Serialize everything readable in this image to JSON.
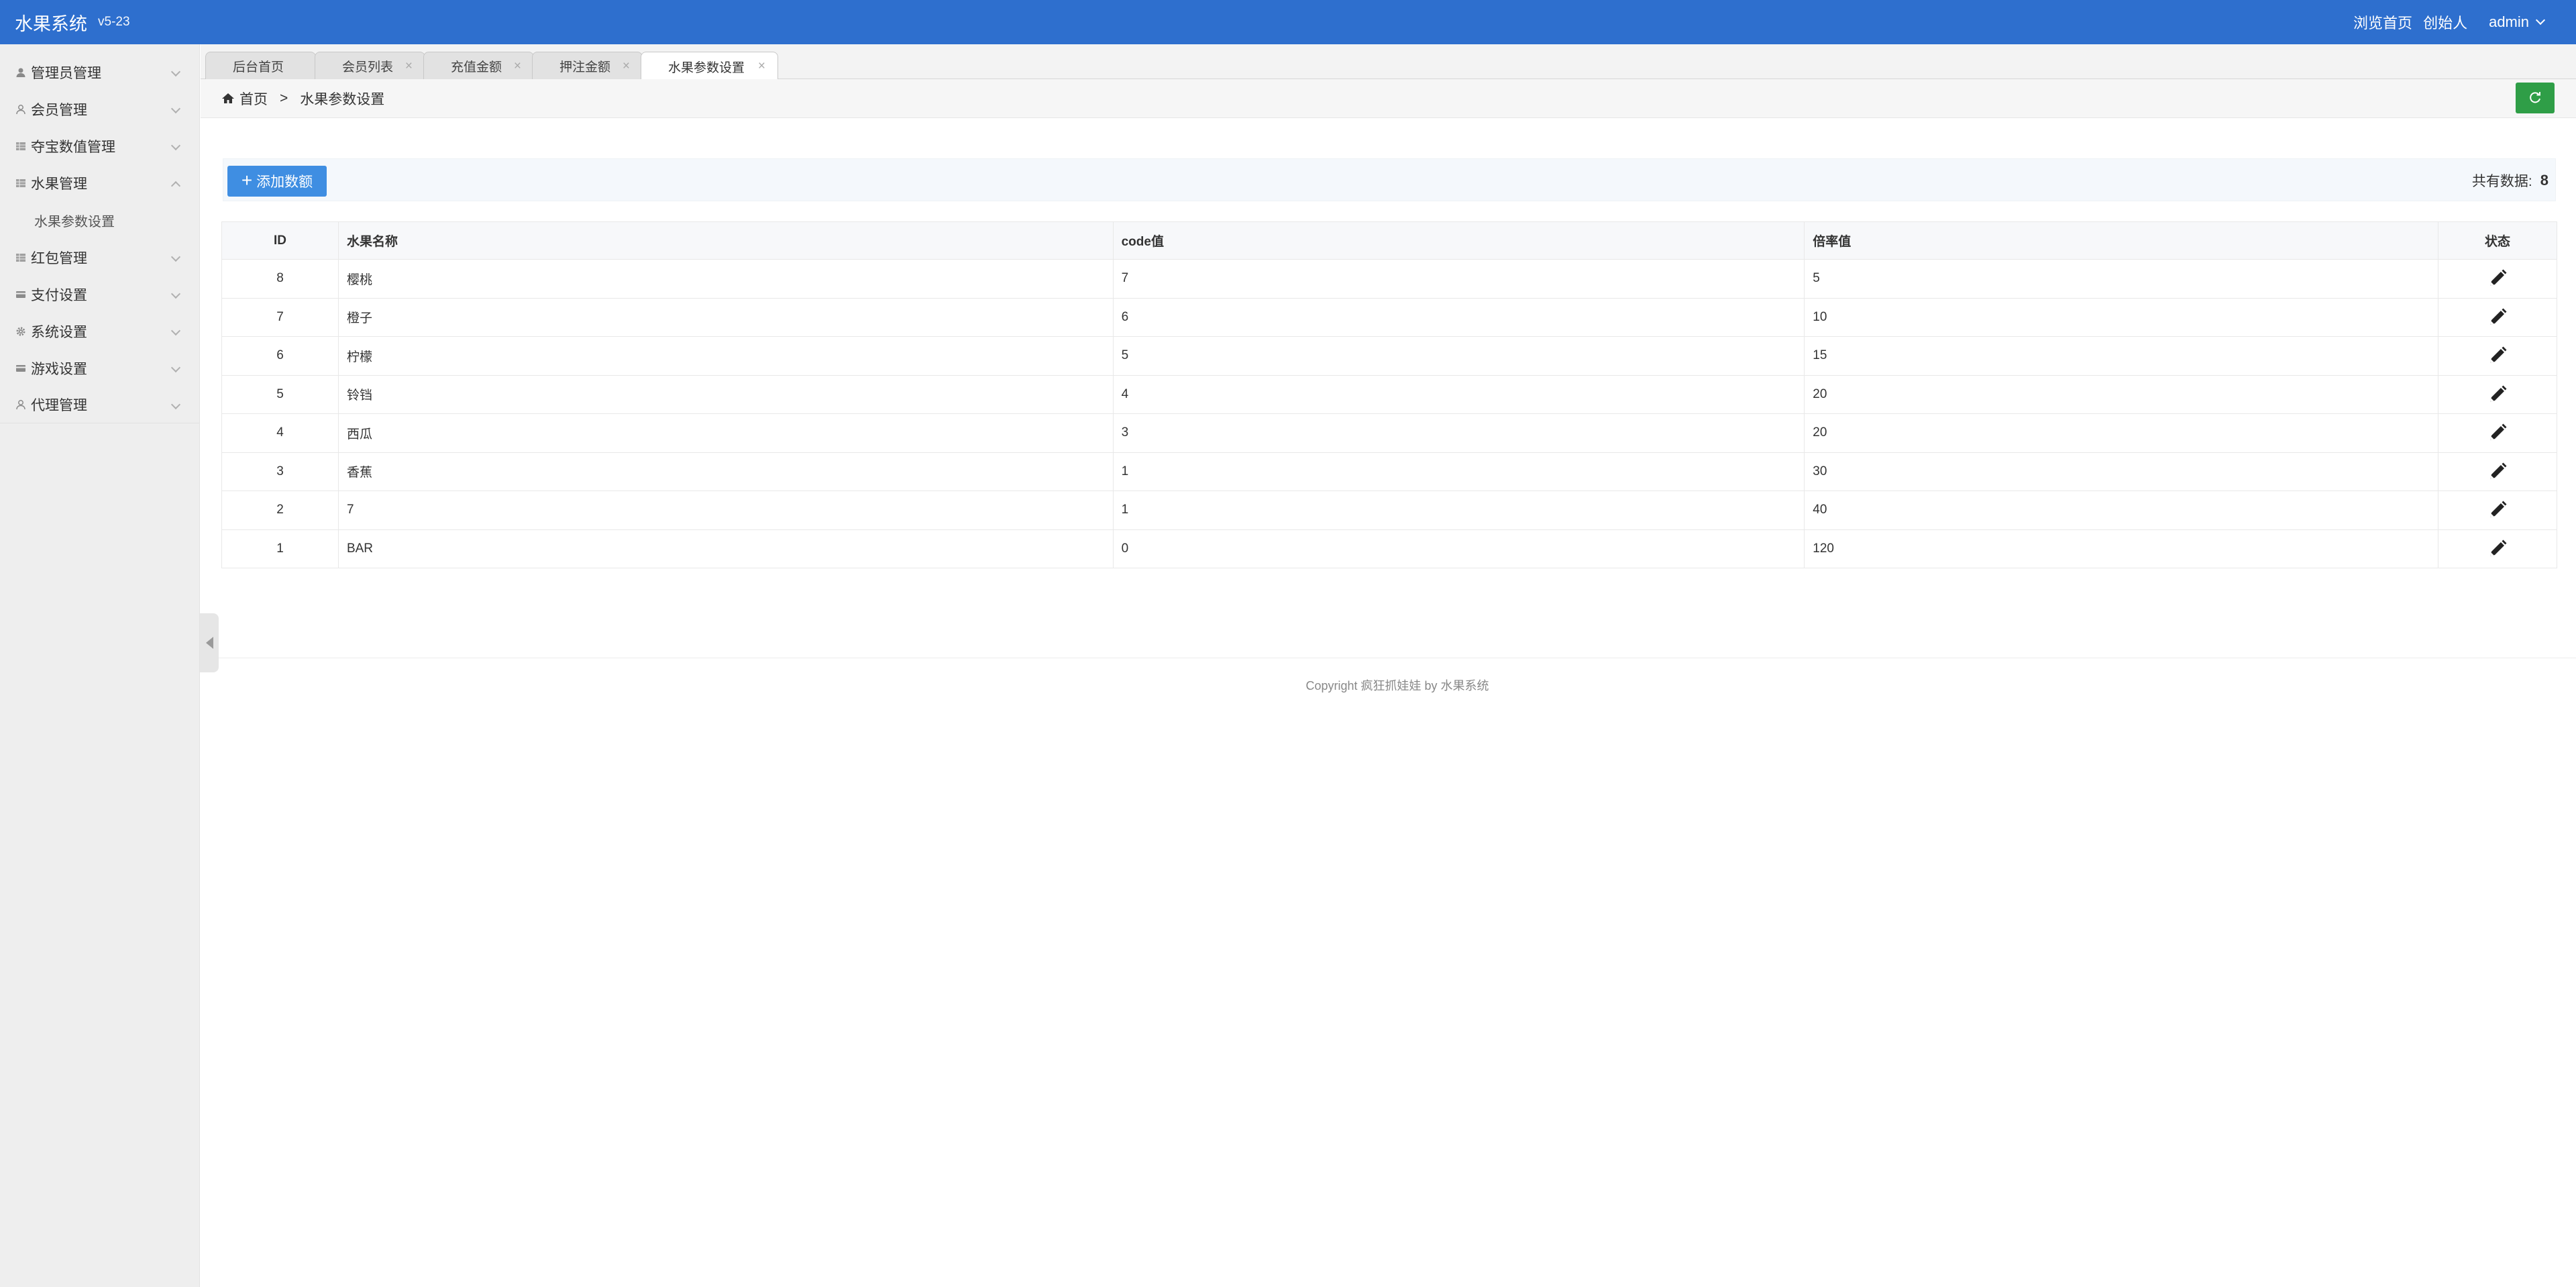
{
  "app": {
    "title": "水果系统",
    "version": "v5-23"
  },
  "header": {
    "browse_home": "浏览首页",
    "role": "创始人",
    "user": "admin"
  },
  "sidebar": {
    "items": [
      {
        "label": "管理员管理"
      },
      {
        "label": "会员管理"
      },
      {
        "label": "夺宝数值管理"
      },
      {
        "label": "水果管理",
        "expanded": true,
        "children": [
          {
            "label": "水果参数设置"
          }
        ]
      },
      {
        "label": "红包管理"
      },
      {
        "label": "支付设置"
      },
      {
        "label": "系统设置"
      },
      {
        "label": "游戏设置"
      },
      {
        "label": "代理管理"
      }
    ]
  },
  "tabs": [
    {
      "label": "后台首页"
    },
    {
      "label": "会员列表"
    },
    {
      "label": "充值金额"
    },
    {
      "label": "押注金额"
    },
    {
      "label": "水果参数设置",
      "active": true
    }
  ],
  "breadcrumb": {
    "home": "首页",
    "separator": ">",
    "current": "水果参数设置"
  },
  "toolbar": {
    "add_label": "添加数额",
    "total_label": "共有数据:",
    "total_value": "8"
  },
  "table": {
    "columns": [
      "ID",
      "水果名称",
      "code值",
      "倍率值",
      "状态"
    ],
    "rows": [
      {
        "id": "8",
        "name": "樱桃",
        "code": "7",
        "rate": "5"
      },
      {
        "id": "7",
        "name": "橙子",
        "code": "6",
        "rate": "10"
      },
      {
        "id": "6",
        "name": "柠檬",
        "code": "5",
        "rate": "15"
      },
      {
        "id": "5",
        "name": "铃铛",
        "code": "4",
        "rate": "20"
      },
      {
        "id": "4",
        "name": "西瓜",
        "code": "3",
        "rate": "20"
      },
      {
        "id": "3",
        "name": "香蕉",
        "code": "1",
        "rate": "30"
      },
      {
        "id": "2",
        "name": "7",
        "code": "1",
        "rate": "40"
      },
      {
        "id": "1",
        "name": "BAR",
        "code": "0",
        "rate": "120"
      }
    ]
  },
  "footer": {
    "copyright": "Copyright 疯狂抓娃娃 by 水果系统"
  },
  "colors": {
    "header": "#2e6fce",
    "primary_button": "#3f8ee2",
    "refresh_button": "#2f9e47",
    "sidebar": "#eeeeee"
  },
  "icons": {
    "sidebar": [
      "user-icon",
      "person-outline-icon",
      "grid-icon",
      "grid-icon",
      "grid-icon",
      "card-icon",
      "gear-icon",
      "card-icon",
      "person-outline-icon"
    ],
    "breadcrumb_home": "home-icon",
    "refresh": "refresh-icon",
    "row_action": "pencil-icon"
  }
}
